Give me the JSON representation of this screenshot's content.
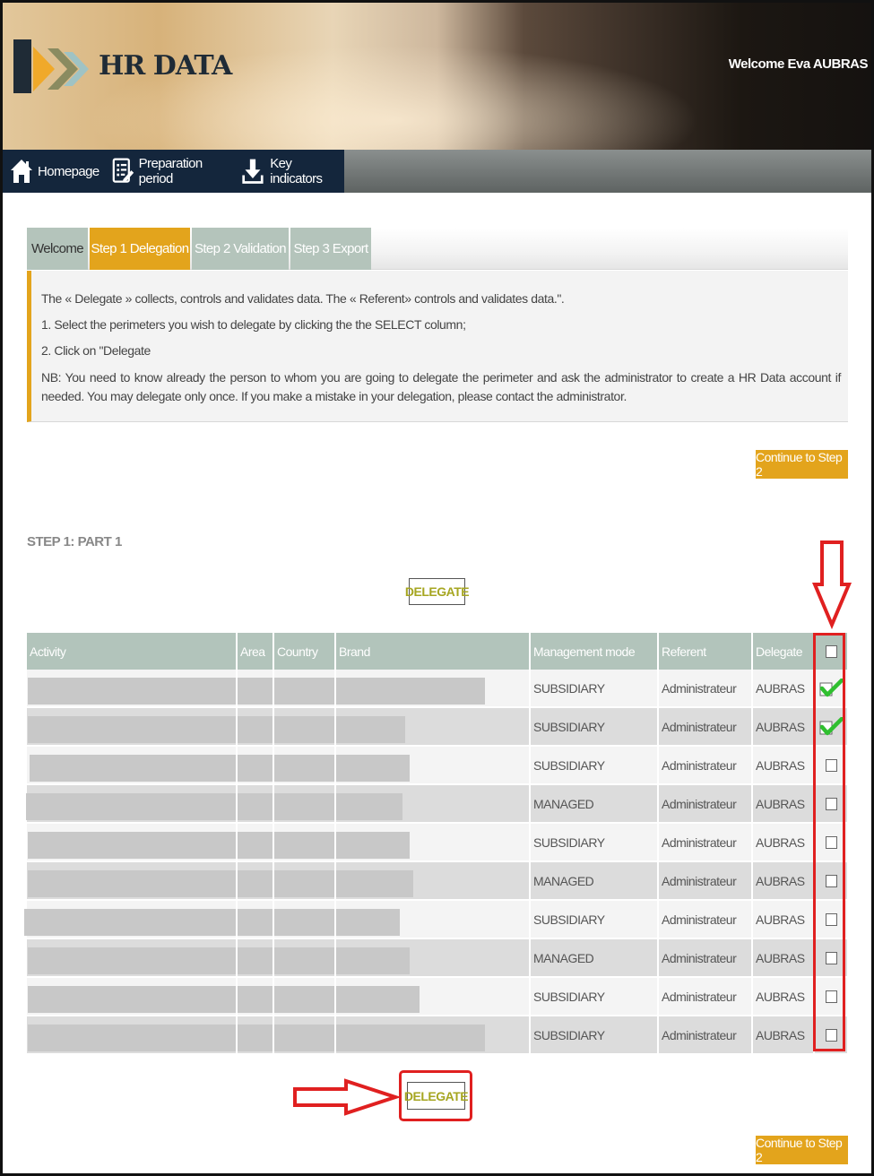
{
  "header": {
    "logo_text": "HR DATA",
    "welcome": "Welcome Eva AUBRAS"
  },
  "nav": [
    {
      "label": "Homepage",
      "icon": "home-icon"
    },
    {
      "label": "Preparation period",
      "icon": "document-edit-icon"
    },
    {
      "label": "Key indicators",
      "icon": "download-icon"
    }
  ],
  "tabs": [
    {
      "label": "Welcome"
    },
    {
      "label": "Step 1 Delegation",
      "active": true
    },
    {
      "label": "Step 2 Validation"
    },
    {
      "label": "Step 3 Export"
    }
  ],
  "info": {
    "line1": "The « Delegate » collects, controls and validates data. The « Referent» controls and validates data.\".",
    "line2": "1. Select the perimeters you wish to delegate by clicking the the SELECT column;",
    "line3": "2. Click on \"Delegate",
    "nb": "NB: You need to know already the person to whom you are going to delegate the perimeter and ask the administrator to create a HR Data account if needed. You may delegate only once. If you make a mistake in your delegation, please contact the administrator."
  },
  "buttons": {
    "continue": "Continue to Step 2",
    "delegate": "DELEGATE"
  },
  "section_title": "STEP 1: PART 1",
  "table": {
    "columns": [
      "Activity",
      "Area",
      "Country",
      "Brand",
      "Management mode",
      "Referent",
      "Delegate"
    ],
    "rows": [
      {
        "mode": "SUBSIDIARY",
        "referent": "Administrateur",
        "delegate": "AUBRAS",
        "selected": true
      },
      {
        "mode": "SUBSIDIARY",
        "referent": "Administrateur",
        "delegate": "AUBRAS",
        "selected": true
      },
      {
        "mode": "SUBSIDIARY",
        "referent": "Administrateur",
        "delegate": "AUBRAS",
        "selected": false
      },
      {
        "mode": "MANAGED",
        "referent": "Administrateur",
        "delegate": "AUBRAS",
        "selected": false
      },
      {
        "mode": "SUBSIDIARY",
        "referent": "Administrateur",
        "delegate": "AUBRAS",
        "selected": false
      },
      {
        "mode": "MANAGED",
        "referent": "Administrateur",
        "delegate": "AUBRAS",
        "selected": false
      },
      {
        "mode": "SUBSIDIARY",
        "referent": "Administrateur",
        "delegate": "AUBRAS",
        "selected": false
      },
      {
        "mode": "MANAGED",
        "referent": "Administrateur",
        "delegate": "AUBRAS",
        "selected": false
      },
      {
        "mode": "SUBSIDIARY",
        "referent": "Administrateur",
        "delegate": "AUBRAS",
        "selected": false
      },
      {
        "mode": "SUBSIDIARY",
        "referent": "Administrateur",
        "delegate": "AUBRAS",
        "selected": false
      }
    ]
  },
  "colors": {
    "accent_orange": "#e3a41c",
    "table_header": "#b2c4bb",
    "nav_dark": "#14263c",
    "annotation_red": "#e02020",
    "check_green": "#2fbf2f"
  }
}
